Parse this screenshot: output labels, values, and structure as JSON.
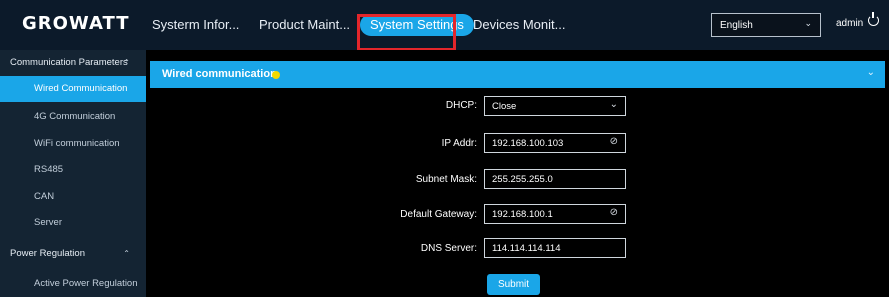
{
  "app": {
    "logo": "GROWATT"
  },
  "nav": {
    "tabs": [
      {
        "label": "Systerm Infor..."
      },
      {
        "label": "Product Maint..."
      },
      {
        "label": "System Settings"
      },
      {
        "label": "Devices Monit..."
      }
    ],
    "active": "System Settings"
  },
  "header": {
    "language": "English",
    "user": "admin"
  },
  "sidebar": {
    "items": [
      {
        "label": "Communication Parameters"
      },
      {
        "label": "Wired Communication"
      },
      {
        "label": "4G Communication"
      },
      {
        "label": "WiFi communication"
      },
      {
        "label": "RS485"
      },
      {
        "label": "CAN"
      },
      {
        "label": "Server"
      },
      {
        "label": "Power Regulation"
      },
      {
        "label": "Active Power Regulation"
      }
    ]
  },
  "panel": {
    "title": "Wired communication",
    "status_color": "#f1d900",
    "fields": [
      {
        "label": "DHCP:",
        "value": "Close",
        "type": "select"
      },
      {
        "label": "IP Addr:",
        "value": "192.168.100.103",
        "type": "input-icon"
      },
      {
        "label": "Subnet Mask:",
        "value": "255.255.255.0",
        "type": "input"
      },
      {
        "label": "Default Gateway:",
        "value": "192.168.100.1",
        "type": "input-icon"
      },
      {
        "label": "DNS Server:",
        "value": "114.114.114.114",
        "type": "input"
      }
    ],
    "submit_label": "Submit"
  },
  "colors": {
    "accent": "#1aa6e8",
    "highlight": "#e4262b",
    "background": "#000000",
    "topbar": "#0c1a2a",
    "sidebar": "#142433"
  }
}
